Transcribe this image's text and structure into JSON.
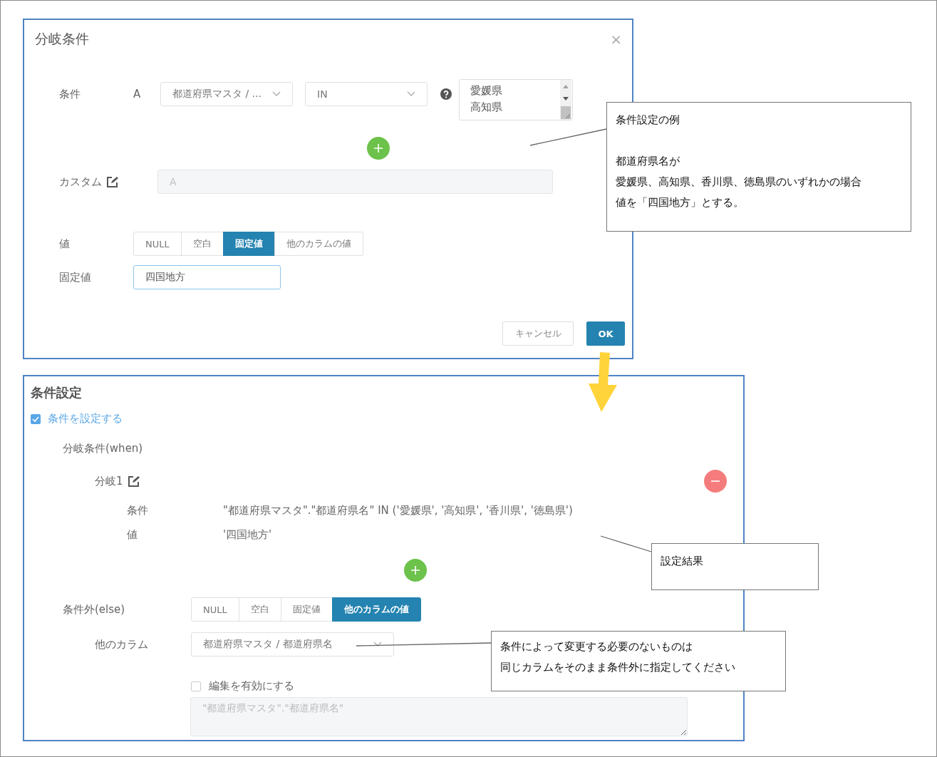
{
  "dialog": {
    "title": "分岐条件",
    "close": "×",
    "condition_row": {
      "label": "条件",
      "alias": "A",
      "column_select": "都道府県マスタ / ...",
      "operator_select": "IN",
      "values_list": [
        "愛媛県",
        "高知県"
      ]
    },
    "custom": {
      "label": "カスタム",
      "placeholder": "A"
    },
    "value_row": {
      "label": "値",
      "options": [
        {
          "label": "NULL",
          "selected": false
        },
        {
          "label": "空白",
          "selected": false
        },
        {
          "label": "固定値",
          "selected": true
        },
        {
          "label": "他のカラムの値",
          "selected": false
        }
      ]
    },
    "fixed_value": {
      "label": "固定値",
      "value": "四国地方"
    },
    "buttons": [
      {
        "label": "キャンセル",
        "kind": "secondary"
      },
      {
        "label": "OK",
        "kind": "primary"
      }
    ]
  },
  "settings": {
    "title": "条件設定",
    "enable": {
      "label": "条件を設定する",
      "checked": true
    },
    "when_label": "分岐条件(when)",
    "branches": [
      {
        "name": "分岐1",
        "condition_label": "条件",
        "condition": "\"都道府県マスタ\".\"都道府県名\" IN ('愛媛県', '高知県', '香川県', '徳島県')",
        "value_label": "値",
        "value": "'四国地方'"
      }
    ],
    "else_row": {
      "label": "条件外(else)",
      "options": [
        {
          "label": "NULL",
          "selected": false
        },
        {
          "label": "空白",
          "selected": false
        },
        {
          "label": "固定値",
          "selected": false
        },
        {
          "label": "他のカラムの値",
          "selected": true
        }
      ]
    },
    "other_column": {
      "label": "他のカラム",
      "value": "都道府県マスタ / 都道府県名"
    },
    "edit_enable": {
      "label": "編集を有効にする",
      "checked": false
    },
    "expression": {
      "placeholder": "\"都道府県マスタ\".\"都道府県名\"",
      "disabled": true
    }
  },
  "callouts": [
    {
      "title": "条件設定の例",
      "lines": [
        "都道府県名が",
        "愛媛県、高知県、香川県、徳島県のいずれかの場合",
        "値を「四国地方」とする。"
      ]
    },
    {
      "title": "設定結果"
    },
    {
      "lines": [
        "条件によって変更する必要のないものは",
        "同じカラムをそのまま条件外に指定してください"
      ]
    }
  ]
}
